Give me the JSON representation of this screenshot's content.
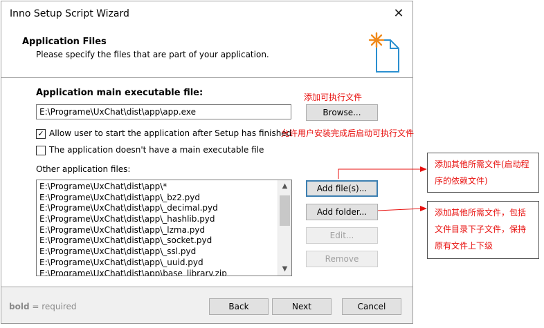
{
  "window": {
    "title": "Inno Setup Script Wizard",
    "close_glyph": "✕"
  },
  "header": {
    "title": "Application Files",
    "subtitle": "Please specify the files that are part of your application.",
    "icon": "new-file-wizard-icon"
  },
  "main_exe": {
    "label": "Application main executable file:",
    "value": "E:\\Programe\\UxChat\\dist\\app\\app.exe",
    "browse_label": "Browse..."
  },
  "checkboxes": [
    {
      "label": "Allow user to start the application after Setup has finished",
      "checked": true,
      "glyph": "✓"
    },
    {
      "label": "The application doesn't have a main executable file",
      "checked": false,
      "glyph": ""
    }
  ],
  "other_files": {
    "label": "Other application files:",
    "items": [
      "E:\\Programe\\UxChat\\dist\\app\\*",
      "E:\\Programe\\UxChat\\dist\\app\\_bz2.pyd",
      "E:\\Programe\\UxChat\\dist\\app\\_decimal.pyd",
      "E:\\Programe\\UxChat\\dist\\app\\_hashlib.pyd",
      "E:\\Programe\\UxChat\\dist\\app\\_lzma.pyd",
      "E:\\Programe\\UxChat\\dist\\app\\_socket.pyd",
      "E:\\Programe\\UxChat\\dist\\app\\_ssl.pyd",
      "E:\\Programe\\UxChat\\dist\\app\\_uuid.pyd",
      "E:\\Programe\\UxChat\\dist\\app\\base_library.zip"
    ],
    "scroll_up": "▲",
    "scroll_down": "▼"
  },
  "side_buttons": {
    "add_files": "Add file(s)...",
    "add_folder": "Add folder...",
    "edit": "Edit...",
    "remove": "Remove"
  },
  "footer": {
    "hint_bold": "bold",
    "hint_rest": " = required",
    "back": "Back",
    "next": "Next",
    "cancel": "Cancel"
  },
  "annotations": {
    "exe": "添加可执行文件",
    "start": "允许用户安装完成后启动可执行文件",
    "add_files": "添加其他所需文件(启动程序的依赖文件)",
    "add_folder": "添加其他所需文件，包括文件目录下子文件，保持原有文件上下级",
    "color": "#e8110f"
  }
}
